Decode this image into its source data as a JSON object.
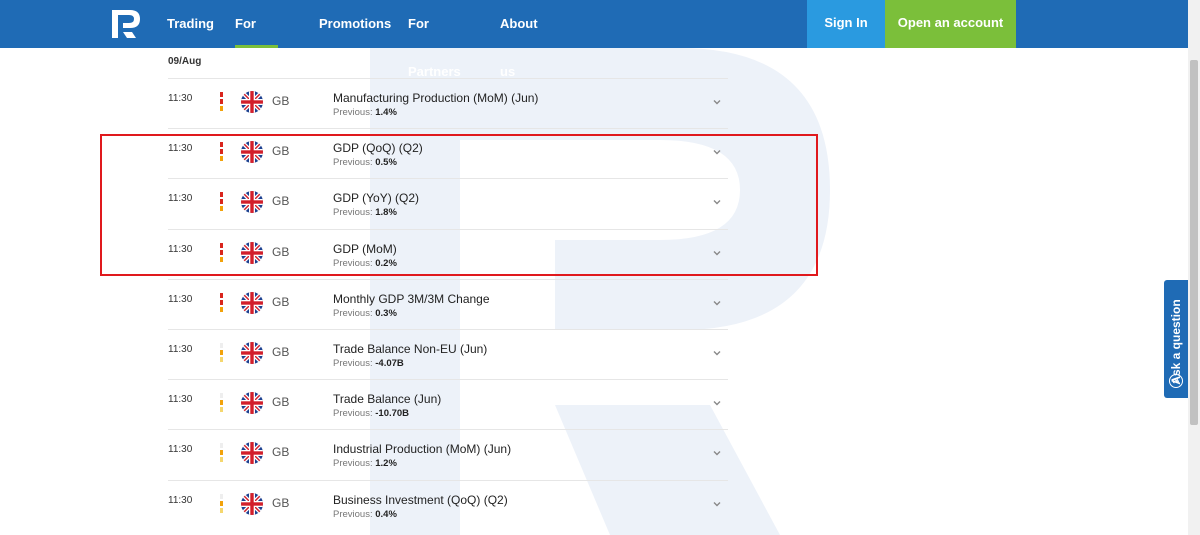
{
  "header": {
    "nav": [
      {
        "label": "Trading",
        "active": false
      },
      {
        "label": "For Clients",
        "active": true
      },
      {
        "label": "Promotions",
        "active": false
      },
      {
        "label": "For Partners",
        "active": false
      },
      {
        "label": "About us",
        "active": false
      }
    ],
    "sign_in": "Sign In",
    "open_account": "Open an account"
  },
  "calendar": {
    "date": "09/Aug",
    "events": [
      {
        "time": "11:30",
        "country": "GB",
        "event": "Manufacturing Production (MoM) (Jun)",
        "previous_label": "Previous:",
        "previous": "1.4%",
        "importance": 3
      },
      {
        "time": "11:30",
        "country": "GB",
        "event": "GDP (QoQ) (Q2)",
        "previous_label": "Previous:",
        "previous": "0.5%",
        "importance": 3
      },
      {
        "time": "11:30",
        "country": "GB",
        "event": "GDP (YoY) (Q2)",
        "previous_label": "Previous:",
        "previous": "1.8%",
        "importance": 3
      },
      {
        "time": "11:30",
        "country": "GB",
        "event": "GDP (MoM)",
        "previous_label": "Previous:",
        "previous": "0.2%",
        "importance": 3
      },
      {
        "time": "11:30",
        "country": "GB",
        "event": "Monthly GDP 3M/3M Change",
        "previous_label": "Previous:",
        "previous": "0.3%",
        "importance": 3
      },
      {
        "time": "11:30",
        "country": "GB",
        "event": "Trade Balance Non-EU (Jun)",
        "previous_label": "Previous:",
        "previous": "-4.07B",
        "importance": 1
      },
      {
        "time": "11:30",
        "country": "GB",
        "event": "Trade Balance (Jun)",
        "previous_label": "Previous:",
        "previous": "-10.70B",
        "importance": 1
      },
      {
        "time": "11:30",
        "country": "GB",
        "event": "Industrial Production (MoM) (Jun)",
        "previous_label": "Previous:",
        "previous": "1.2%",
        "importance": 1
      },
      {
        "time": "11:30",
        "country": "GB",
        "event": "Business Investment (QoQ) (Q2)",
        "previous_label": "Previous:",
        "previous": "0.4%",
        "importance": 1
      }
    ]
  },
  "ask_question": "Ask a question",
  "colors": {
    "header_bg": "#1f6bb5",
    "sign_in_bg": "#2a9ae0",
    "open_account_bg": "#7bbf3a",
    "importance_high": "#d9251d",
    "importance_mid": "#f2a20a",
    "importance_low": "#f5d76e",
    "highlight_border": "#e0191d"
  },
  "icons": {
    "logo": "roboforex-logo-icon",
    "flag": "uk-flag-icon",
    "expand": "chevron-down-icon",
    "ask": "question-circle-icon"
  }
}
